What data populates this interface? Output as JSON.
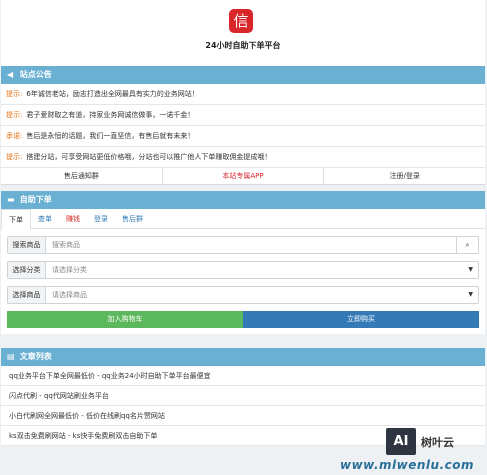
{
  "header": {
    "logo_glyph": "信",
    "title": "24小时自助下单平台"
  },
  "notice": {
    "title": "站点公告",
    "items": [
      {
        "tag": "提示:",
        "tag_color": "#e8751a",
        "text": "6年诚信老站，励志打造出全网最具有实力的业务网站！"
      },
      {
        "tag": "提示:",
        "tag_color": "#e8751a",
        "text": "君子爱财取之有道，持家业务网诚信做事，一诺千金！"
      },
      {
        "tag": "承诺:",
        "tag_color": "#e8751a",
        "text": "售后是永恒的话题，我们一直坚信，有售后就有未来！"
      },
      {
        "tag": "提示:",
        "tag_color": "#e8751a",
        "text": "搭建分站，可享受网站更低价格哦，分站也可以推广他人下单赚取佣金提成哦！"
      }
    ],
    "links": [
      {
        "label": "售后通知群",
        "color": "#333333"
      },
      {
        "label": "本站专属APP",
        "color": "#d9262a"
      },
      {
        "label": "注册/登录",
        "color": "#333333"
      }
    ]
  },
  "order": {
    "title": "自助下单",
    "tabs": [
      {
        "label": "下单",
        "color": "#333333"
      },
      {
        "label": "查单",
        "color": "#337ab7"
      },
      {
        "label": "赚钱",
        "color": "#d9262a"
      },
      {
        "label": "登录",
        "color": "#337ab7"
      },
      {
        "label": "售后群",
        "color": "#337ab7"
      }
    ],
    "search": {
      "label": "搜索商品",
      "placeholder": "搜索商品"
    },
    "category": {
      "label": "选择分类",
      "value": "请选择分类"
    },
    "product": {
      "label": "选择商品",
      "value": "请选择商品"
    },
    "add_cart": "加入购物车",
    "buy_now": "立即购买"
  },
  "articles": {
    "title": "文章列表",
    "items": [
      "qq业务平台下单全网最低价 - qq业务24小时自助下单平台最便宜",
      "闪点代刷 - qq代网站刷业务平台",
      "小白代刷网全网最低价 - 低价在线刷qq名片赞网站",
      "ks双击免费刷网站 - ks快手免费刷双击自助下单"
    ]
  },
  "watermark": {
    "badge": "AI",
    "name": "树叶云",
    "url": "www.mlwenlu.com"
  }
}
